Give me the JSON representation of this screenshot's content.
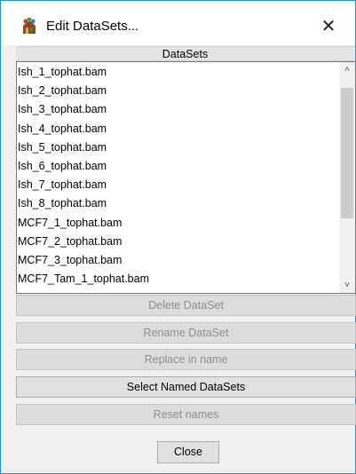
{
  "window": {
    "title": "Edit DataSets...",
    "close_glyph": "✕",
    "app_icon": "data-app-icon"
  },
  "datasets": {
    "header": "DataSets",
    "items": [
      "Ish_1_tophat.bam",
      "Ish_2_tophat.bam",
      "Ish_3_tophat.bam",
      "Ish_4_tophat.bam",
      "Ish_5_tophat.bam",
      "Ish_6_tophat.bam",
      "Ish_7_tophat.bam",
      "Ish_8_tophat.bam",
      "MCF7_1_tophat.bam",
      "MCF7_2_tophat.bam",
      "MCF7_3_tophat.bam",
      "MCF7_Tam_1_tophat.bam"
    ],
    "scroll_up_glyph": "˄",
    "scroll_down_glyph": "˅"
  },
  "buttons": {
    "delete": "Delete DataSet",
    "rename": "Rename DataSet",
    "replace": "Replace in name",
    "select_named": "Select Named DataSets",
    "reset": "Reset names",
    "close": "Close"
  },
  "colors": {
    "window_border": "#2b8fd6",
    "disabled_text": "#8f8f8f",
    "dialog_background": "#f0f0f0"
  }
}
